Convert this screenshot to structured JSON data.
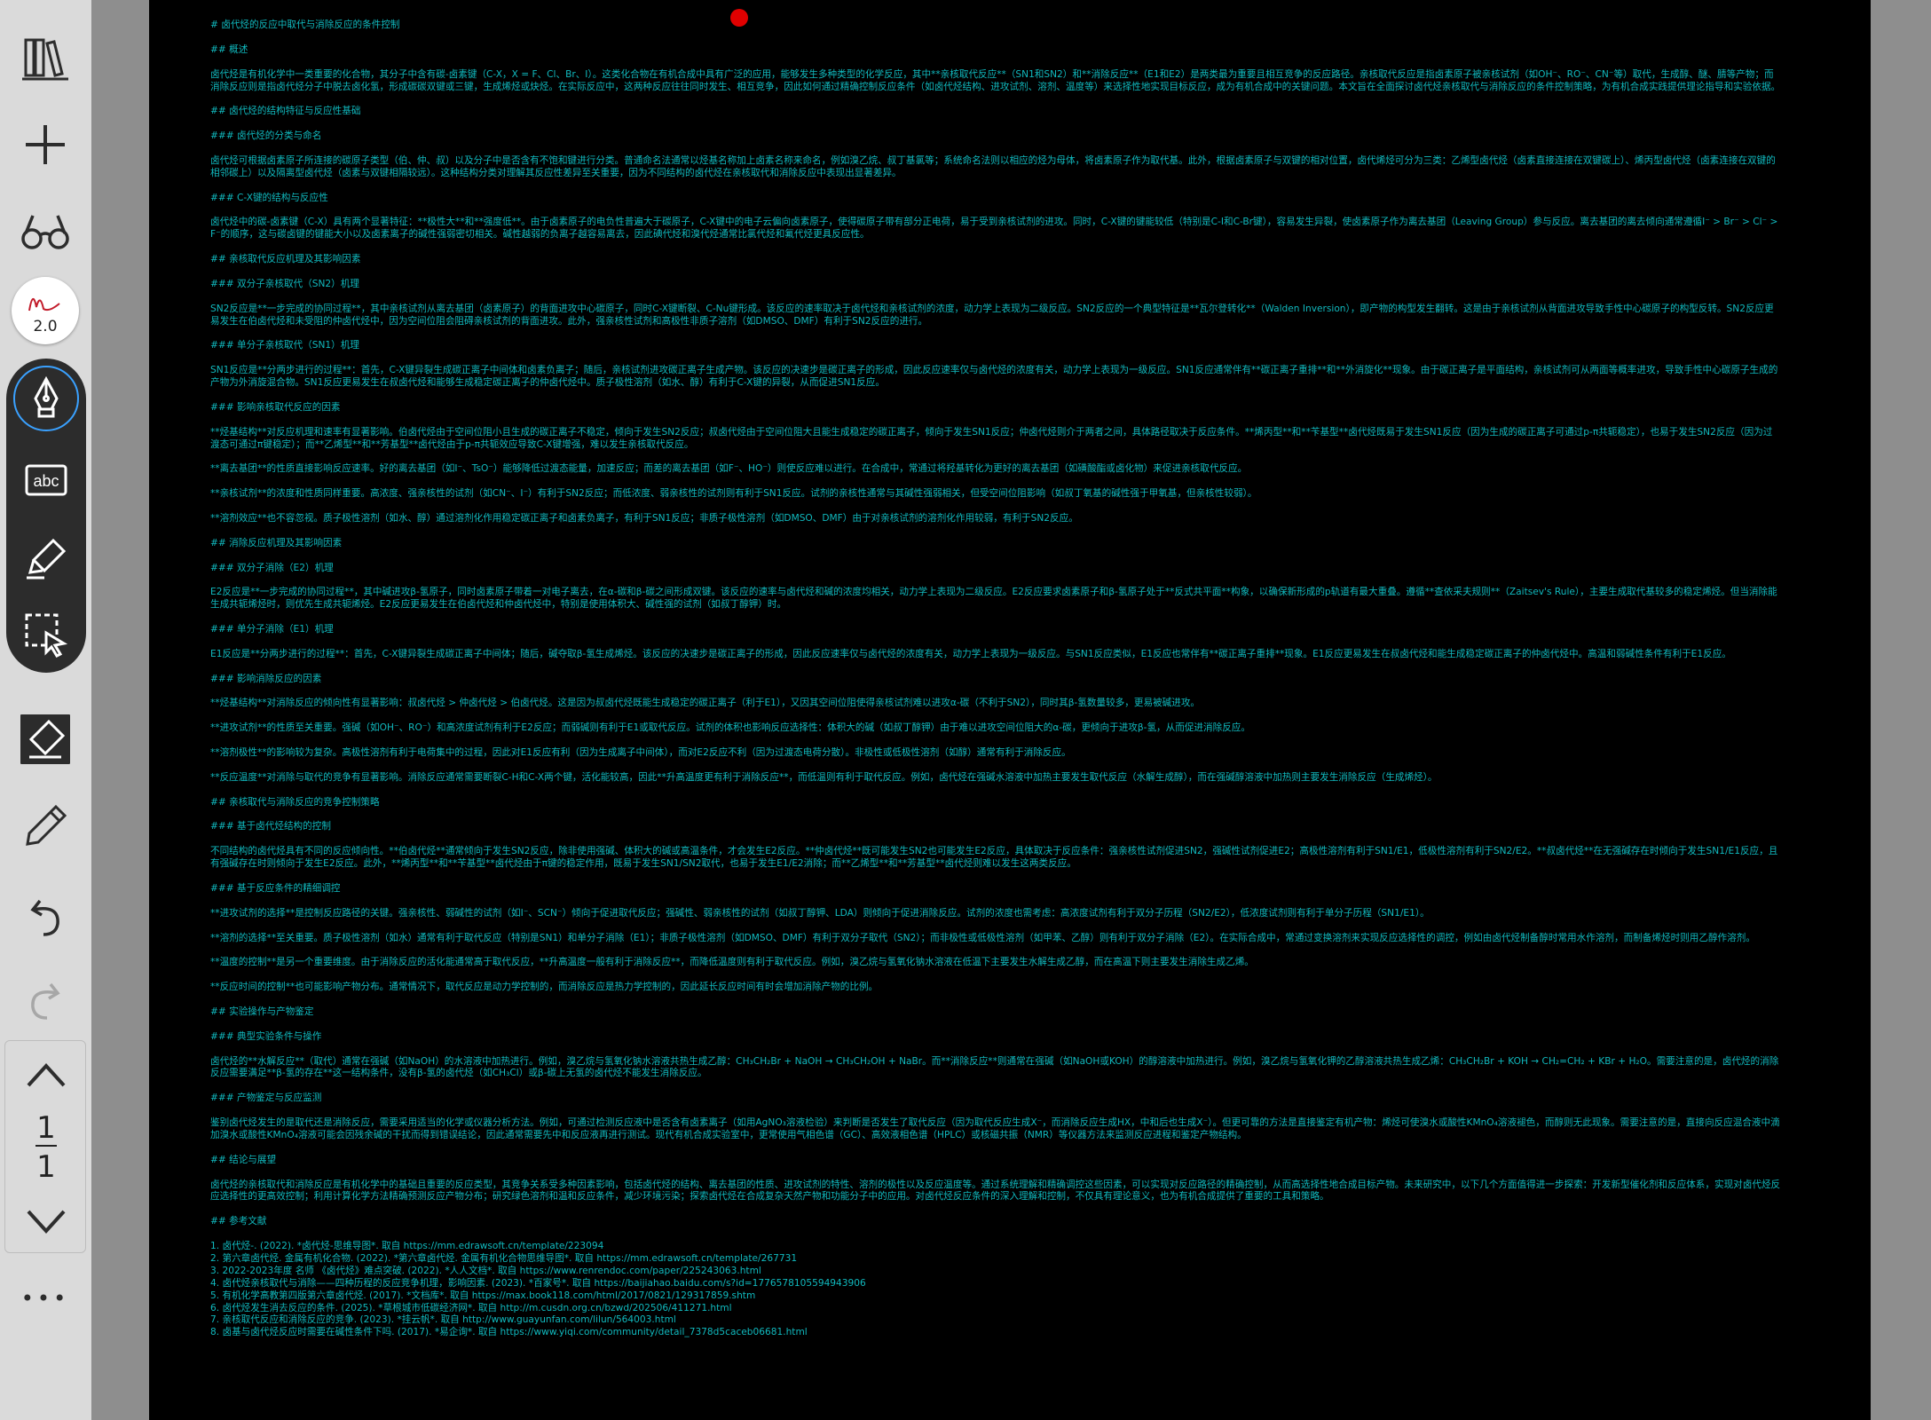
{
  "toolbar": {
    "library_icon": "library-books-icon",
    "add_icon": "plus-icon",
    "view_icon": "reading-glasses-icon",
    "pen_size": "2.0",
    "tools": [
      "pen-icon",
      "text-box-icon",
      "highlighter-icon",
      "lasso-select-icon",
      "eraser-icon",
      "pencil-icon"
    ],
    "text_tool_label": "abc",
    "undo_icon": "undo-icon",
    "redo_icon": "redo-icon",
    "page_current": "1",
    "page_total": "1",
    "more_label": "•••",
    "accent_color": "#3aa1ff"
  },
  "document": {
    "text_color": "#10b9be",
    "background": "#000000",
    "blocks": [
      "# 卤代烃的反应中取代与消除反应的条件控制",
      "## 概述",
      "卤代烃是有机化学中一类重要的化合物，其分子中含有碳-卤素键（C-X，X = F、Cl、Br、I）。这类化合物在有机合成中具有广泛的应用，能够发生多种类型的化学反应，其中**亲核取代反应**（SN1和SN2）和**消除反应**（E1和E2）是两类最为重要且相互竞争的反应路径。亲核取代反应是指卤素原子被亲核试剂（如OH⁻、RO⁻、CN⁻等）取代，生成醇、醚、腈等产物；而消除反应则是指卤代烃分子中脱去卤化氢，形成碳碳双键或三键，生成烯烃或炔烃。在实际反应中，这两种反应往往同时发生、相互竞争，因此如何通过精确控制反应条件（如卤代烃结构、进攻试剂、溶剂、温度等）来选择性地实现目标反应，成为有机合成中的关键问题。本文旨在全面探讨卤代烃亲核取代与消除反应的条件控制策略，为有机合成实践提供理论指导和实验依据。",
      "## 卤代烃的结构特征与反应性基础",
      "### 卤代烃的分类与命名",
      "卤代烃可根据卤素原子所连接的碳原子类型（伯、仲、叔）以及分子中是否含有不饱和键进行分类。普通命名法通常以烃基名称加上卤素名称来命名，例如溴乙烷、叔丁基氯等；系统命名法则以相应的烃为母体，将卤素原子作为取代基。此外，根据卤素原子与双键的相对位置，卤代烯烃可分为三类：乙烯型卤代烃（卤素直接连接在双键碳上）、烯丙型卤代烃（卤素连接在双键的相邻碳上）以及隔离型卤代烃（卤素与双键相隔较远）。这种结构分类对理解其反应性差异至关重要，因为不同结构的卤代烃在亲核取代和消除反应中表现出显著差异。",
      "### C-X键的结构与反应性",
      "卤代烃中的碳-卤素键（C-X）具有两个显著特征：**极性大**和**强度低**。由于卤素原子的电负性普遍大于碳原子，C-X键中的电子云偏向卤素原子，使得碳原子带有部分正电荷，易于受到亲核试剂的进攻。同时，C-X键的键能较低（特别是C-I和C-Br键），容易发生异裂，使卤素原子作为离去基团（Leaving Group）参与反应。离去基团的离去倾向通常遵循I⁻ > Br⁻ > Cl⁻ > F⁻的顺序，这与碳卤键的键能大小以及卤素离子的碱性强弱密切相关。碱性越弱的负离子越容易离去，因此碘代烃和溴代烃通常比氯代烃和氟代烃更具反应性。",
      "## 亲核取代反应机理及其影响因素",
      "### 双分子亲核取代（SN2）机理",
      "SN2反应是**一步完成的协同过程**，其中亲核试剂从离去基团（卤素原子）的背面进攻中心碳原子，同时C-X键断裂、C-Nu键形成。该反应的速率取决于卤代烃和亲核试剂的浓度，动力学上表现为二级反应。SN2反应的一个典型特征是**瓦尔登转化**（Walden Inversion），即产物的构型发生翻转。这是由于亲核试剂从背面进攻导致手性中心碳原子的构型反转。SN2反应更易发生在伯卤代烃和未受阻的仲卤代烃中，因为空间位阻会阻碍亲核试剂的背面进攻。此外，强亲核性试剂和高极性非质子溶剂（如DMSO、DMF）有利于SN2反应的进行。",
      "### 单分子亲核取代（SN1）机理",
      "SN1反应是**分两步进行的过程**：首先，C-X键异裂生成碳正离子中间体和卤素负离子；随后，亲核试剂进攻碳正离子生成产物。该反应的决速步是碳正离子的形成，因此反应速率仅与卤代烃的浓度有关，动力学上表现为一级反应。SN1反应通常伴有**碳正离子重排**和**外消旋化**现象。由于碳正离子是平面结构，亲核试剂可从两面等概率进攻，导致手性中心碳原子生成的产物为外消旋混合物。SN1反应更易发生在叔卤代烃和能够生成稳定碳正离子的仲卤代烃中。质子极性溶剂（如水、醇）有利于C-X键的异裂，从而促进SN1反应。",
      "### 影响亲核取代反应的因素",
      "**烃基结构**对反应机理和速率有显著影响。伯卤代烃由于空间位阻小且生成的碳正离子不稳定，倾向于发生SN2反应；叔卤代烃由于空间位阻大且能生成稳定的碳正离子，倾向于发生SN1反应；仲卤代烃则介于两者之间，具体路径取决于反应条件。**烯丙型**和**苄基型**卤代烃既易于发生SN1反应（因为生成的碳正离子可通过p-π共轭稳定），也易于发生SN2反应（因为过渡态可通过π键稳定）；而**乙烯型**和**芳基型**卤代烃由于p-π共轭效应导致C-X键增强，难以发生亲核取代反应。",
      "**离去基团**的性质直接影响反应速率。好的离去基团（如I⁻、TsO⁻）能够降低过渡态能量，加速反应；而差的离去基团（如F⁻、HO⁻）则使反应难以进行。在合成中，常通过将羟基转化为更好的离去基团（如磺酸酯或卤化物）来促进亲核取代反应。",
      "**亲核试剂**的浓度和性质同样重要。高浓度、强亲核性的试剂（如CN⁻、I⁻）有利于SN2反应；而低浓度、弱亲核性的试剂则有利于SN1反应。试剂的亲核性通常与其碱性强弱相关，但受空间位阻影响（如叔丁氧基的碱性强于甲氧基，但亲核性较弱）。",
      "**溶剂效应**也不容忽视。质子极性溶剂（如水、醇）通过溶剂化作用稳定碳正离子和卤素负离子，有利于SN1反应；非质子极性溶剂（如DMSO、DMF）由于对亲核试剂的溶剂化作用较弱，有利于SN2反应。",
      "## 消除反应机理及其影响因素",
      "### 双分子消除（E2）机理",
      "E2反应是**一步完成的协同过程**，其中碱进攻β-氢原子，同时卤素原子带着一对电子离去，在α-碳和β-碳之间形成双键。该反应的速率与卤代烃和碱的浓度均相关，动力学上表现为二级反应。E2反应要求卤素原子和β-氢原子处于**反式共平面**构象，以确保新形成的p轨道有最大重叠。遵循**查依采夫规则**（Zaitsev's Rule），主要生成取代基较多的稳定烯烃。但当消除能生成共轭烯烃时，则优先生成共轭烯烃。E2反应更易发生在伯卤代烃和仲卤代烃中，特别是使用体积大、碱性强的试剂（如叔丁醇钾）时。",
      "### 单分子消除（E1）机理",
      "E1反应是**分两步进行的过程**：首先，C-X键异裂生成碳正离子中间体；随后，碱夺取β-氢生成烯烃。该反应的决速步是碳正离子的形成，因此反应速率仅与卤代烃的浓度有关，动力学上表现为一级反应。与SN1反应类似，E1反应也常伴有**碳正离子重排**现象。E1反应更易发生在叔卤代烃和能生成稳定碳正离子的仲卤代烃中。高温和弱碱性条件有利于E1反应。",
      "### 影响消除反应的因素",
      "**烃基结构**对消除反应的倾向性有显著影响：叔卤代烃 > 仲卤代烃 > 伯卤代烃。这是因为叔卤代烃既能生成稳定的碳正离子（利于E1），又因其空间位阻使得亲核试剂难以进攻α-碳（不利于SN2），同时其β-氢数量较多，更易被碱进攻。",
      "**进攻试剂**的性质至关重要。强碱（如OH⁻、RO⁻）和高浓度试剂有利于E2反应；而弱碱则有利于E1或取代反应。试剂的体积也影响反应选择性：体积大的碱（如叔丁醇钾）由于难以进攻空间位阻大的α-碳，更倾向于进攻β-氢，从而促进消除反应。",
      "**溶剂极性**的影响较为复杂。高极性溶剂有利于电荷集中的过程，因此对E1反应有利（因为生成离子中间体），而对E2反应不利（因为过渡态电荷分散）。非极性或低极性溶剂（如醇）通常有利于消除反应。",
      "**反应温度**对消除与取代的竞争有显著影响。消除反应通常需要断裂C-H和C-X两个键，活化能较高，因此**升高温度更有利于消除反应**，而低温则有利于取代反应。例如，卤代烃在强碱水溶液中加热主要发生取代反应（水解生成醇），而在强碱醇溶液中加热则主要发生消除反应（生成烯烃）。",
      "## 亲核取代与消除反应的竞争控制策略",
      "### 基于卤代烃结构的控制",
      "不同结构的卤代烃具有不同的反应倾向性。**伯卤代烃**通常倾向于发生SN2反应，除非使用强碱、体积大的碱或高温条件，才会发生E2反应。**仲卤代烃**既可能发生SN2也可能发生E2反应，具体取决于反应条件：强亲核性试剂促进SN2，强碱性试剂促进E2；高极性溶剂有利于SN1/E1，低极性溶剂有利于SN2/E2。**叔卤代烃**在无强碱存在时倾向于发生SN1/E1反应，且有强碱存在时则倾向于发生E2反应。此外，**烯丙型**和**苄基型**卤代烃由于π键的稳定作用，既易于发生SN1/SN2取代，也易于发生E1/E2消除；而**乙烯型**和**芳基型**卤代烃则难以发生这两类反应。",
      "### 基于反应条件的精细调控",
      "**进攻试剂的选择**是控制反应路径的关键。强亲核性、弱碱性的试剂（如I⁻、SCN⁻）倾向于促进取代反应；强碱性、弱亲核性的试剂（如叔丁醇钾、LDA）则倾向于促进消除反应。试剂的浓度也需考虑：高浓度试剂有利于双分子历程（SN2/E2），低浓度试剂则有利于单分子历程（SN1/E1）。",
      "**溶剂的选择**至关重要。质子极性溶剂（如水）通常有利于取代反应（特别是SN1）和单分子消除（E1）；非质子极性溶剂（如DMSO、DMF）有利于双分子取代（SN2）；而非极性或低极性溶剂（如甲苯、乙醇）则有利于双分子消除（E2）。在实际合成中，常通过变换溶剂来实现反应选择性的调控，例如由卤代烃制备醇时常用水作溶剂，而制备烯烃时则用乙醇作溶剂。",
      "**温度的控制**是另一个重要维度。由于消除反应的活化能通常高于取代反应，**升高温度一般有利于消除反应**，而降低温度则有利于取代反应。例如，溴乙烷与氢氧化钠水溶液在低温下主要发生水解生成乙醇，而在高温下则主要发生消除生成乙烯。",
      "**反应时间的控制**也可能影响产物分布。通常情况下，取代反应是动力学控制的，而消除反应是热力学控制的，因此延长反应时间有时会增加消除产物的比例。",
      "## 实验操作与产物鉴定",
      "### 典型实验条件与操作",
      "卤代烃的**水解反应**（取代）通常在强碱（如NaOH）的水溶液中加热进行。例如，溴乙烷与氢氧化钠水溶液共热生成乙醇：CH₃CH₂Br + NaOH → CH₃CH₂OH + NaBr。而**消除反应**则通常在强碱（如NaOH或KOH）的醇溶液中加热进行。例如，溴乙烷与氢氧化钾的乙醇溶液共热生成乙烯：CH₃CH₂Br + KOH → CH₂=CH₂ + KBr + H₂O。需要注意的是，卤代烃的消除反应需要满足**β-氢的存在**这一结构条件，没有β-氢的卤代烃（如CH₃Cl）或β-碳上无氢的卤代烃不能发生消除反应。",
      "### 产物鉴定与反应监测",
      "鉴别卤代烃发生的是取代还是消除反应，需要采用适当的化学或仪器分析方法。例如，可通过检测反应液中是否含有卤素离子（如用AgNO₃溶液检验）来判断是否发生了取代反应（因为取代反应生成X⁻，而消除反应生成HX，中和后也生成X⁻）。但更可靠的方法是直接鉴定有机产物：烯烃可使溴水或酸性KMnO₄溶液褪色，而醇则无此现象。需要注意的是，直接向反应混合液中滴加溴水或酸性KMnO₄溶液可能会因残余碱的干扰而得到错误结论，因此通常需要先中和反应液再进行测试。现代有机合成实验室中，更常使用气相色谱（GC）、高效液相色谱（HPLC）或核磁共振（NMR）等仪器方法来监测反应进程和鉴定产物结构。",
      "## 结论与展望",
      "卤代烃的亲核取代和消除反应是有机化学中的基础且重要的反应类型，其竞争关系受多种因素影响，包括卤代烃的结构、离去基团的性质、进攻试剂的特性、溶剂的极性以及反应温度等。通过系统理解和精确调控这些因素，可以实现对反应路径的精确控制，从而高选择性地合成目标产物。未来研究中，以下几个方面值得进一步探索：开发新型催化剂和反应体系，实现对卤代烃反应选择性的更高效控制；利用计算化学方法精确预测反应产物分布；研究绿色溶剂和温和反应条件，减少环境污染；探索卤代烃在合成复杂天然产物和功能分子中的应用。对卤代烃反应条件的深入理解和控制，不仅具有理论意义，也为有机合成提供了重要的工具和策略。",
      "## 参考文献"
    ],
    "references": [
      "1.  卤代烃-. (2022). *卤代烃-思维导图*. 取自 https://mm.edrawsoft.cn/template/223094",
      "2.  第六章卤代烃. 金属有机化合物. (2022). *第六章卤代烃. 金属有机化合物思维导图*. 取自 https://mm.edrawsoft.cn/template/267731",
      "3.  2022-2023年度 名师 《卤代烃》难点突破. (2022). *人人文档*. 取自 https://www.renrendoc.com/paper/225243063.html",
      "4.  卤代烃亲核取代与消除——四种历程的反应竞争机理，影响因素. (2023). *百家号*. 取自 https://baijiahao.baidu.com/s?id=1776578105594943906",
      "5.  有机化学高教第四版第六章卤代烃. (2017). *文档库*. 取自 https://max.book118.com/html/2017/0821/129317859.shtm",
      "6.  卤代烃发生消去反应的条件. (2025). *草根城市低碳经济网*. 取自 http://m.cusdn.org.cn/bzwd/202506/411271.html",
      "7.  亲核取代反应和消除反应的竞争. (2023). *挂云帆*. 取自 http://www.guayunfan.com/lilun/564003.html",
      "8.  卤基与卤代烃反应时需要在碱性条件下吗. (2017). *易企询*. 取自 https://www.yiqi.com/community/detail_7378d5caceb06681.html"
    ]
  }
}
